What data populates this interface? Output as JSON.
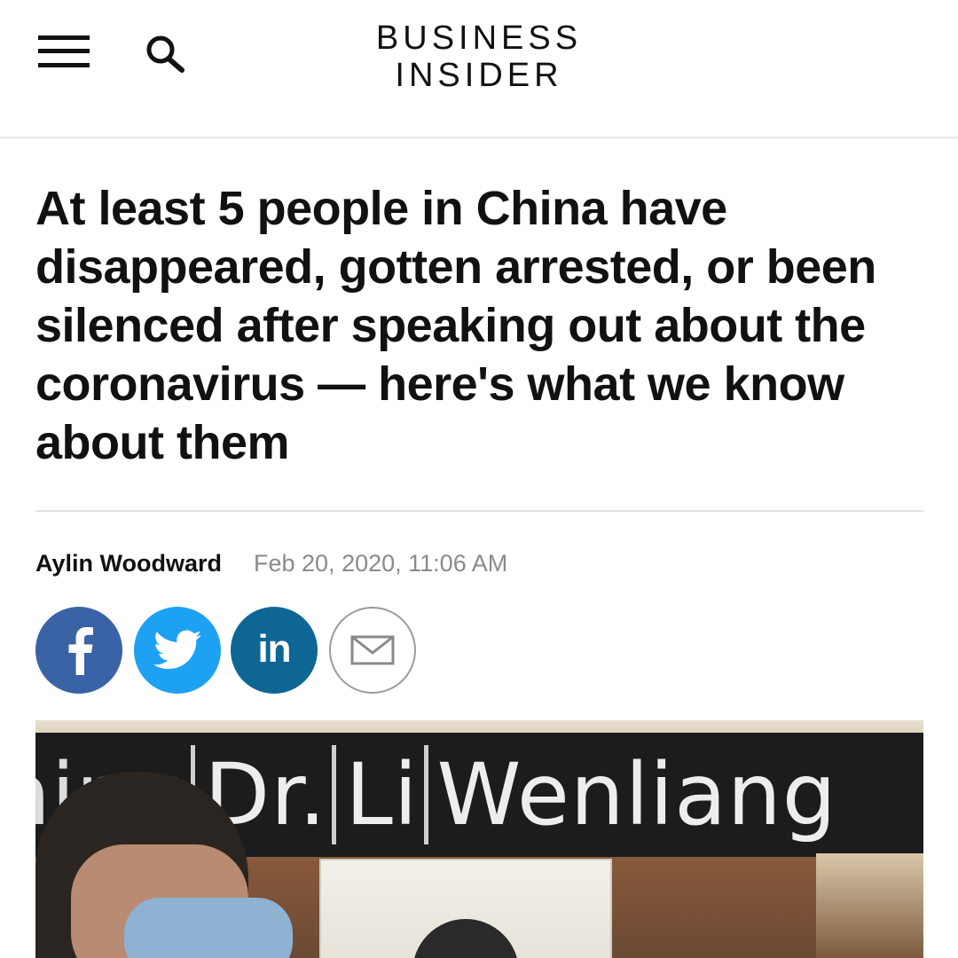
{
  "header": {
    "menu_icon": "hamburger-menu-icon",
    "search_icon": "search-icon",
    "logo_line1": "BUSINESS",
    "logo_line2": "INSIDER"
  },
  "article": {
    "headline": "At least 5 people in China have disappeared, gotten arrested, or been silenced after speaking out about the coronavirus — here's what we know about them",
    "author": "Aylin Woodward",
    "date": "Feb 20, 2020, 11:06 AM"
  },
  "share": {
    "facebook_icon": "facebook-icon",
    "twitter_icon": "twitter-icon",
    "linkedin_label": "in",
    "email_icon": "email-icon",
    "colors": {
      "facebook": "#3a63a6",
      "twitter": "#1da1f2",
      "linkedin": "#0e6694"
    }
  },
  "photo": {
    "banner_partial": "ning",
    "banner_words": [
      "Dr.",
      "Li",
      "Wenliang"
    ]
  }
}
